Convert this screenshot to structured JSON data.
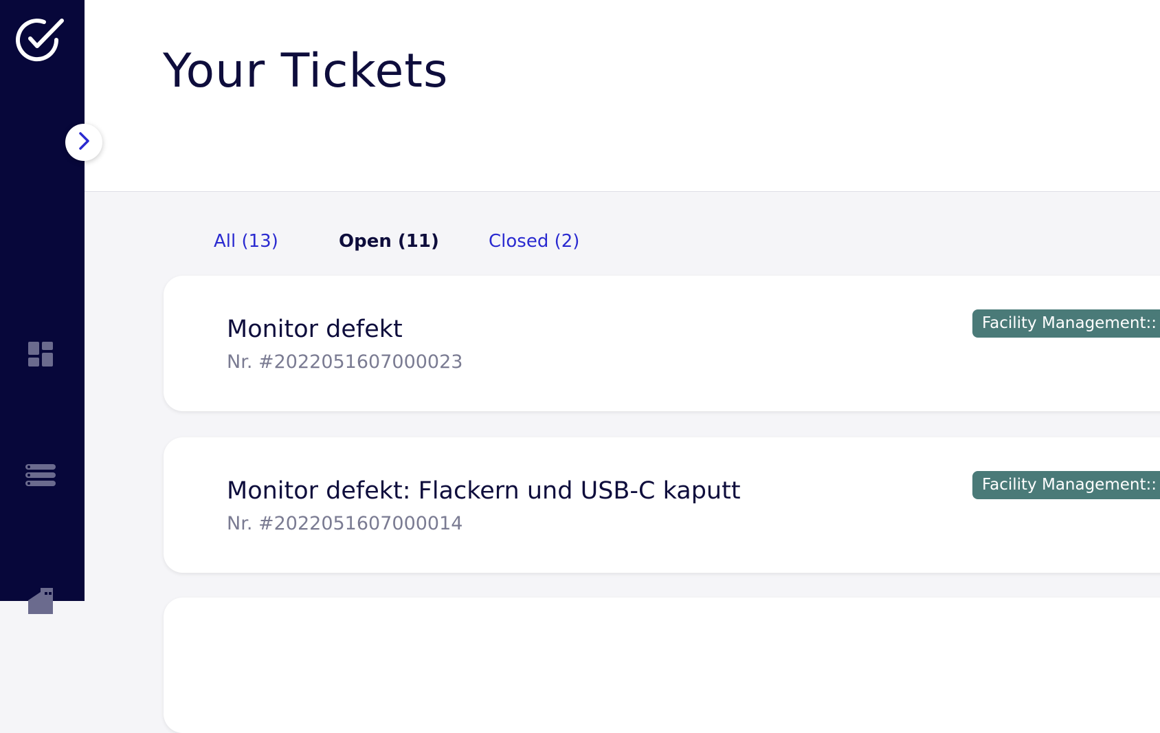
{
  "header": {
    "title": "Your Tickets"
  },
  "tabs": [
    {
      "label": "All (13)",
      "active": false
    },
    {
      "label": "Open (11)",
      "active": true
    },
    {
      "label": "Closed (2)",
      "active": false
    }
  ],
  "tickets": [
    {
      "title": "Monitor defekt",
      "number": "Nr. #2022051607000023",
      "category": "Facility Management::"
    },
    {
      "title": "Monitor defekt: Flackern und USB-C kaputt",
      "number": "Nr. #2022051607000014",
      "category": "Facility Management::"
    }
  ],
  "sidebar": {
    "icons": [
      "check-circle-logo-icon",
      "dashboard-icon",
      "list-icon",
      "building-icon"
    ],
    "toggle_icon": "chevron-right-icon"
  },
  "colors": {
    "sidebar_bg": "#07073a",
    "accent": "#2a2ad0",
    "badge_bg": "#4a7a78",
    "title_text": "#0e0d3c",
    "muted_text": "#7a7b92"
  }
}
